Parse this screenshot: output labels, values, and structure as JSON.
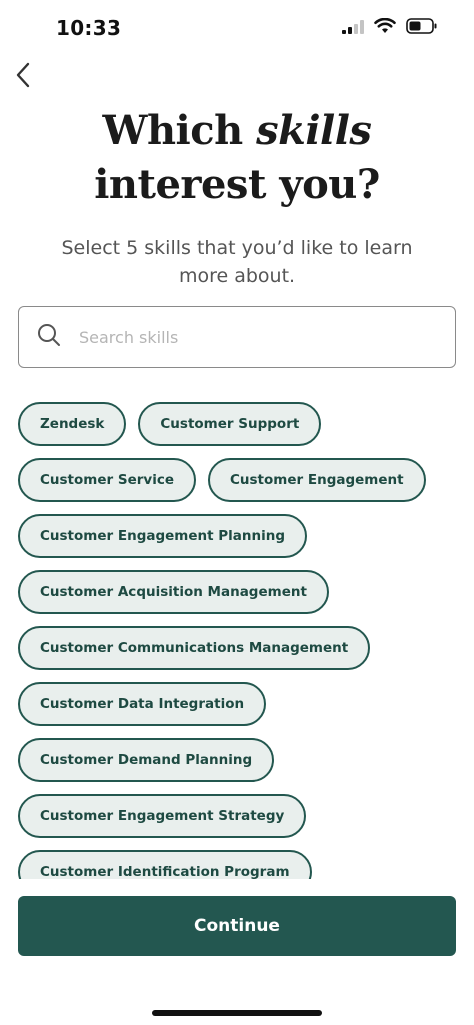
{
  "status_bar": {
    "time": "10:33",
    "icons": [
      "signal-icon",
      "wifi-icon",
      "battery-icon"
    ]
  },
  "header": {
    "back_icon": "chevron-left-icon",
    "title_part1": "Which ",
    "title_emphasis": "skills",
    "title_part2": "interest you?",
    "subtitle": "Select 5 skills that you’d like to learn more about."
  },
  "search": {
    "icon": "search-icon",
    "placeholder": "Search skills",
    "value": ""
  },
  "skills": [
    "Zendesk",
    "Customer Support",
    "Customer Service",
    "Customer Engagement",
    "Customer Engagement Planning",
    "Customer Acquisition Management",
    "Customer Communications Management",
    "Customer Data Integration",
    "Customer Demand Planning",
    "Customer Engagement Strategy",
    "Customer Identification Program"
  ],
  "footer": {
    "continue_label": "Continue"
  },
  "colors": {
    "accent": "#235750",
    "chip_background": "#e9efed",
    "chip_text": "#1e4a42"
  }
}
